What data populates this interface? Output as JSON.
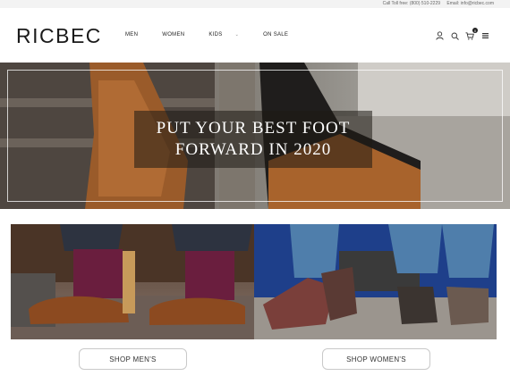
{
  "topbar": {
    "phone": "Call Toll free: (800) 510-2229",
    "email": "Email: info@ricbec.com"
  },
  "header": {
    "logo": "RICBEC",
    "nav": [
      {
        "label": "MEN"
      },
      {
        "label": "WOMEN"
      },
      {
        "label": "KIDS"
      },
      {
        "label": "ON SALE"
      }
    ],
    "cart_count": "0",
    "icons": [
      "user-icon",
      "search-icon",
      "cart-icon",
      "menu-icon"
    ]
  },
  "hero": {
    "line1": "PUT YOUR BEST FOOT",
    "line2": "FORWARD IN 2020"
  },
  "promos": {
    "men_button": "SHOP MEN'S",
    "women_button": "SHOP WOMEN'S"
  }
}
